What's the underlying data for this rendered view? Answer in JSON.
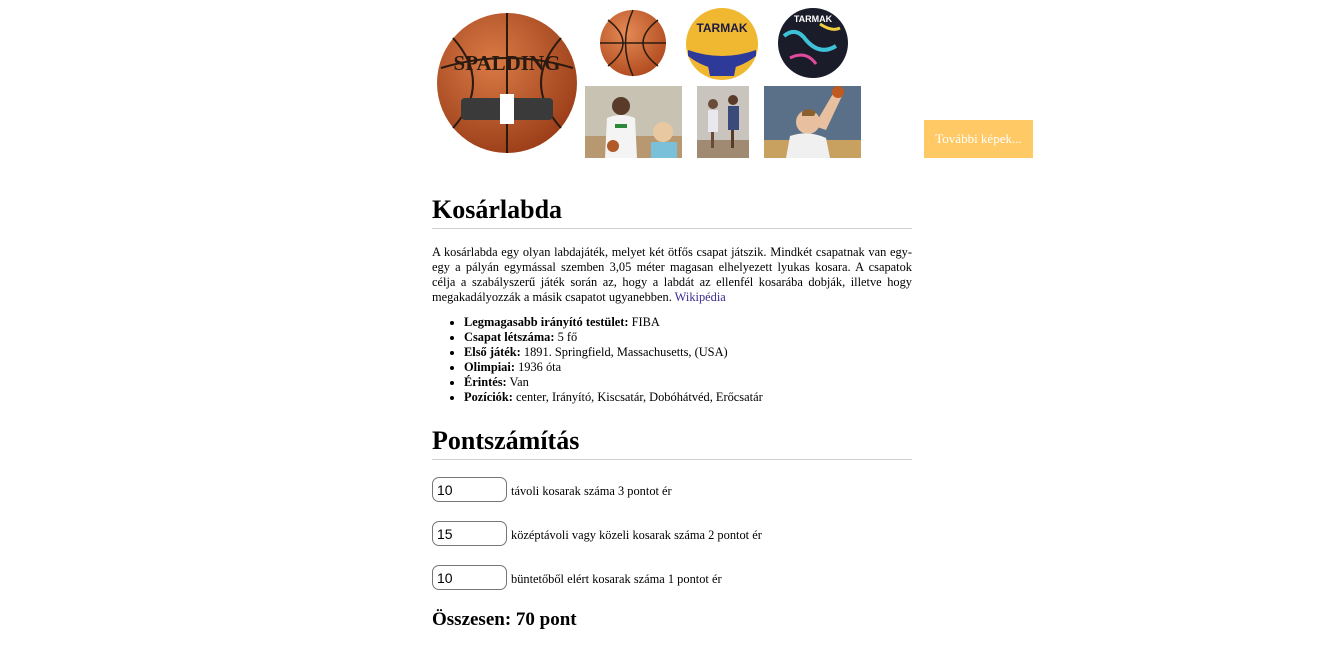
{
  "gallery": {
    "images": [
      {
        "name": "spalding-ball-image",
        "depicts": "Spalding basketball",
        "text": "SPALDING"
      },
      {
        "name": "orange-ball-image",
        "depicts": "basketball"
      },
      {
        "name": "tarmak-yellow-ball-image",
        "depicts": "Tarmak BT500 ball",
        "text": "TARMAK"
      },
      {
        "name": "tarmak-hardground-ball-image",
        "depicts": "Tarmak hardground ball",
        "text": "TARMAK"
      },
      {
        "name": "player-white-jersey-image",
        "depicts": "basketball player"
      },
      {
        "name": "players-game-image",
        "depicts": "basketball game"
      },
      {
        "name": "player-shooting-image",
        "depicts": "player shooting"
      }
    ],
    "more_button": "További képek..."
  },
  "article": {
    "title": "Kosárlabda",
    "description": "A kosárlabda egy olyan labdajáték, melyet két ötfős csapat játszik. Mindkét csapatnak van egy-egy a pályán egymással szemben 3,05 méter magasan elhelyezett lyukas kosara. A csapatok célja a szabályszerű játék során az, hogy a labdát az ellenfél kosarába dobják, illetve hogy megakadályozzák a másik csapatot ugyanebben.",
    "source_link": "Wikipédia",
    "facts": [
      {
        "label": "Legmagasabb irányító testület:",
        "value": "FIBA"
      },
      {
        "label": "Csapat létszáma:",
        "value": "5 fő"
      },
      {
        "label": "Első játék:",
        "value": "1891. Springfield, Massachusetts, (USA)"
      },
      {
        "label": "Olimpiai:",
        "value": "1936 óta"
      },
      {
        "label": "Érintés:",
        "value": "Van"
      },
      {
        "label": "Pozíciók:",
        "value": "center, Irányító, Kiscsatár, Dobóhátvéd, Erőcsatár"
      }
    ]
  },
  "scoring": {
    "title": "Pontszámítás",
    "rows": [
      {
        "value": "10",
        "label": "távoli kosarak száma 3 pontot ér"
      },
      {
        "value": "15",
        "label": "középtávoli vagy közeli kosarak száma 2 pontot ér"
      },
      {
        "value": "10",
        "label": "büntetőből elért kosarak száma 1 pontot ér"
      }
    ],
    "total": "Összesen: 70 pont"
  },
  "colors": {
    "button_bg": "#ffc966",
    "link": "#3b2c8f",
    "ball_orange": "#c85a28"
  }
}
